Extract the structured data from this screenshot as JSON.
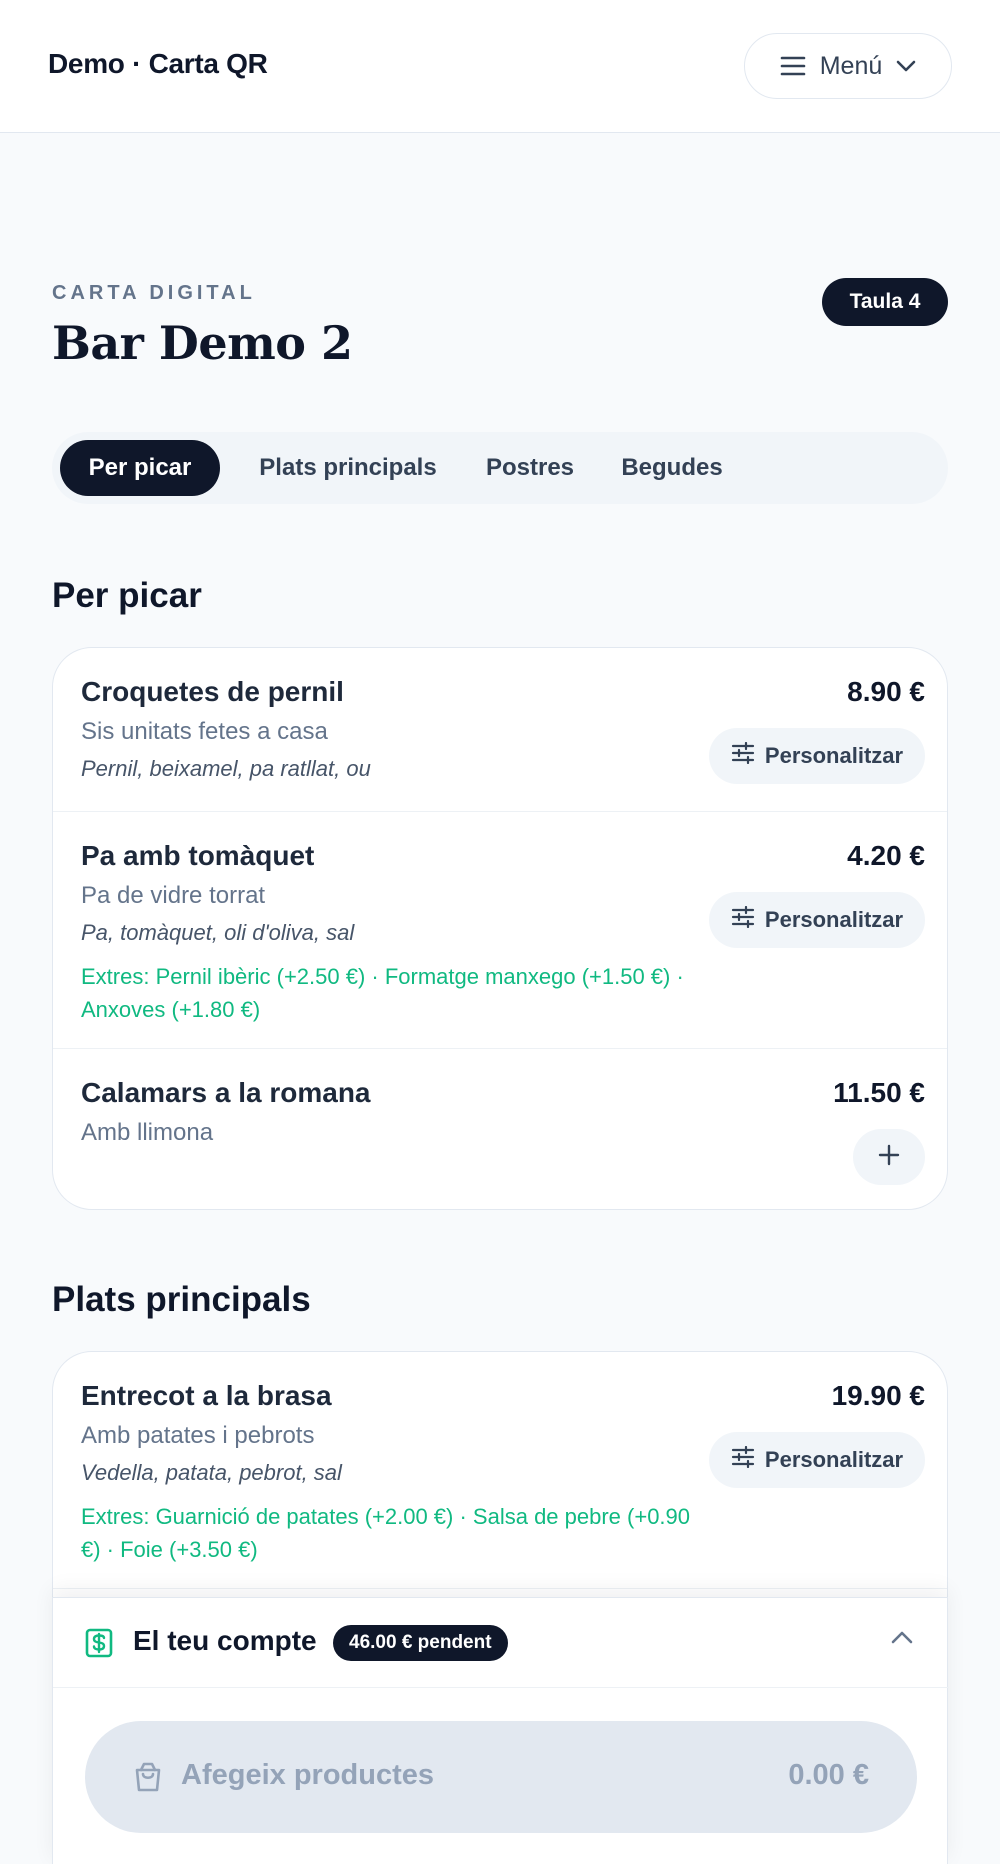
{
  "header": {
    "brand": "Demo · Carta QR",
    "menu_label": "Menú"
  },
  "hero": {
    "eyebrow": "CARTA DIGITAL",
    "title": "Bar Demo 2",
    "table_badge": "Taula 4"
  },
  "tabs": [
    {
      "label": "Per picar",
      "active": true
    },
    {
      "label": "Plats principals",
      "active": false
    },
    {
      "label": "Postres",
      "active": false
    },
    {
      "label": "Begudes",
      "active": false
    }
  ],
  "sections": [
    {
      "title": "Per picar",
      "items": [
        {
          "name": "Croquetes de pernil",
          "description": "Sis unitats fetes a casa",
          "ingredients": "Pernil, beixamel, pa ratllat, ou",
          "extras": "",
          "price": "8.90 €",
          "action_label": "Personalitzar"
        },
        {
          "name": "Pa amb tomàquet",
          "description": "Pa de vidre torrat",
          "ingredients": "Pa, tomàquet, oli d'oliva, sal",
          "extras": "Extres: Pernil ibèric (+2.50 €) · Formatge manxego (+1.50 €) · Anxoves (+1.80 €)",
          "price": "4.20 €",
          "action_label": "Personalitzar"
        },
        {
          "name": "Calamars a la romana",
          "description": "Amb llimona",
          "ingredients": "",
          "extras": "",
          "price": "11.50 €",
          "action_label": ""
        }
      ]
    },
    {
      "title": "Plats principals",
      "items": [
        {
          "name": "Entrecot a la brasa",
          "description": "Amb patates i pebrots",
          "ingredients": "Vedella, patata, pebrot, sal",
          "extras": "Extres: Guarnició de patates (+2.00 €) · Salsa de pebre (+0.90 €) · Foie (+3.50 €)",
          "price": "19.90 €",
          "action_label": "Personalitzar"
        }
      ]
    }
  ],
  "account": {
    "title": "El teu compte",
    "pending_badge": "46.00 € pendent",
    "checkout_label": "Afegeix productes",
    "checkout_total": "0.00 €"
  },
  "icons": {
    "menu": "hamburger-icon",
    "dropdown": "chevron-down-icon",
    "customize": "sliders-icon",
    "add": "plus-icon",
    "account": "dollar-receipt-icon",
    "collapse": "chevron-up-icon",
    "cart": "shopping-bag-icon"
  },
  "colors": {
    "primary": "#0f172a",
    "extras_green": "#10b981",
    "muted": "#64748b",
    "surface": "#f1f5f9"
  }
}
